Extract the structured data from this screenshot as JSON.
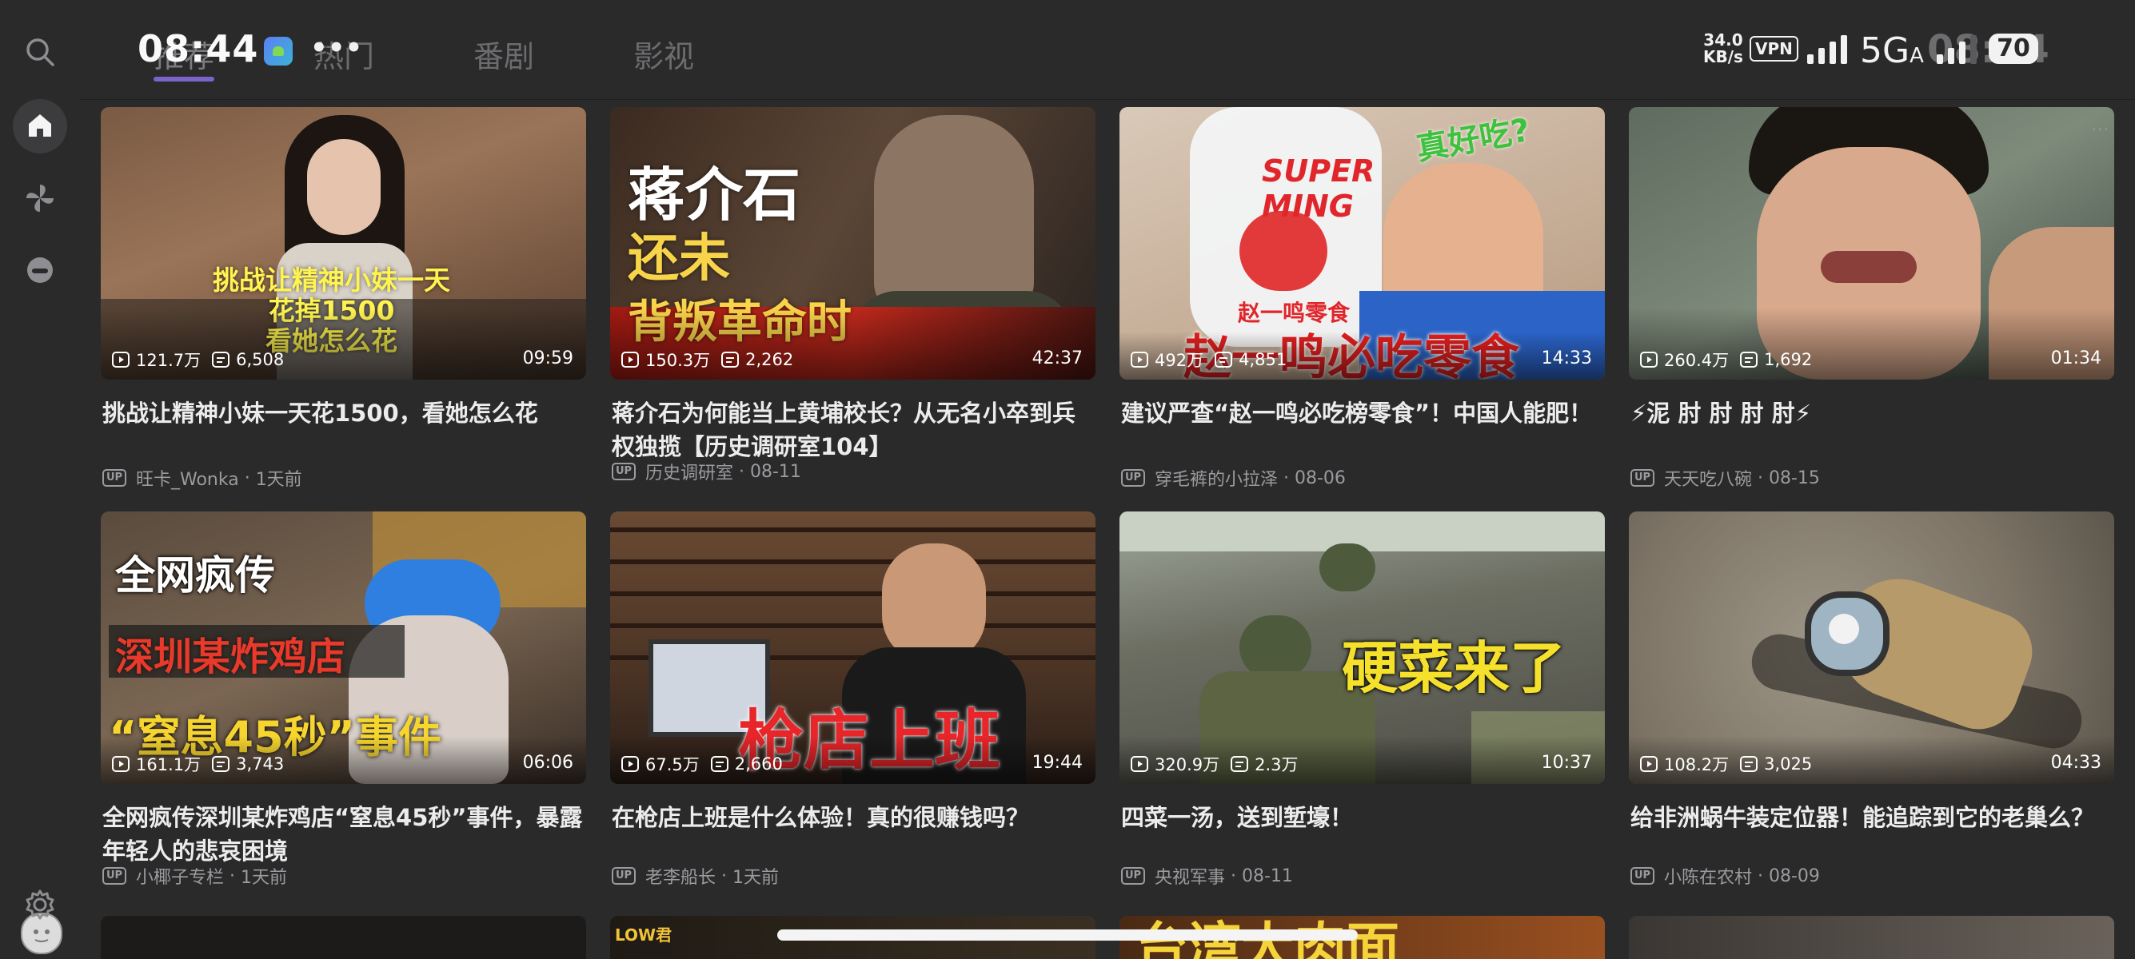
{
  "status_bar": {
    "time": "08:44",
    "speed_value": "34.0",
    "speed_unit": "KB/s",
    "vpn": "VPN",
    "network": "5G",
    "network_sub": "A",
    "battery": "70",
    "ghost_time": "08:44"
  },
  "tabs": [
    "推荐",
    "热门",
    "番剧",
    "影视"
  ],
  "active_tab": "推荐",
  "sidebar": {
    "items": [
      "home",
      "pinwheel",
      "bangumi",
      "avatar",
      "settings"
    ]
  },
  "videos": [
    {
      "title": "挑战让精神小妹一天花1500，看她怎么花",
      "views": "121.7万",
      "danmaku": "6,508",
      "duration": "09:59",
      "author": "旺卡_Wonka",
      "date": "1天前",
      "caption": "挑战让精神小妹一天\n花掉1500\n看她怎么花"
    },
    {
      "title": "蒋介石为何能当上黄埔校长？从无名小卒到兵权独揽【历史调研室104】",
      "views": "150.3万",
      "danmaku": "2,262",
      "duration": "42:37",
      "author": "历史调研室",
      "date": "08-11",
      "caption": "蒋介石\n还未\n背叛革命时"
    },
    {
      "title": "建议严查“赵一鸣必吃榜零食”！中国人能肥！",
      "views": "492万",
      "danmaku": "4,851",
      "duration": "14:33",
      "author": "穿毛裤的小拉泽",
      "date": "08-06",
      "caption": "赵一鸣必吃零食",
      "caption2": "真好吃?",
      "caption3": "SUPER MING",
      "caption4": "赵一鸣零食"
    },
    {
      "title": "⚡泥 肘 肘 肘 肘⚡",
      "views": "260.4万",
      "danmaku": "1,692",
      "duration": "01:34",
      "author": "天天吃八碗",
      "date": "08-15",
      "more": "···"
    },
    {
      "title": "全网疯传深圳某炸鸡店“窒息45秒”事件，暴露年轻人的悲哀困境",
      "views": "161.1万",
      "danmaku": "3,743",
      "duration": "06:06",
      "author": "小椰子专栏",
      "date": "1天前",
      "caption": "全网疯传",
      "caption2": "深圳某炸鸡店",
      "caption3": "“窒息45秒”事件"
    },
    {
      "title": "在枪店上班是什么体验！真的很赚钱吗？",
      "views": "67.5万",
      "danmaku": "2,660",
      "duration": "19:44",
      "author": "老李船长",
      "date": "1天前",
      "caption": "枪店上班"
    },
    {
      "title": "四菜一汤，送到堑壕！",
      "views": "320.9万",
      "danmaku": "2.3万",
      "duration": "10:37",
      "author": "央视军事",
      "date": "08-11",
      "caption": "硬菜来了"
    },
    {
      "title": "给非洲蜗牛装定位器！能追踪到它的老巢么？",
      "views": "108.2万",
      "danmaku": "3,025",
      "duration": "04:33",
      "author": "小陈在农村",
      "date": "08-09"
    }
  ],
  "partial_row": {
    "caption_left": "LOW君",
    "caption_right": "台湾大肉面"
  },
  "colors": {
    "background": "#2a2a2b",
    "accent": "#7a63c9",
    "text": "#ececec",
    "meta": "#9b9b9f"
  }
}
